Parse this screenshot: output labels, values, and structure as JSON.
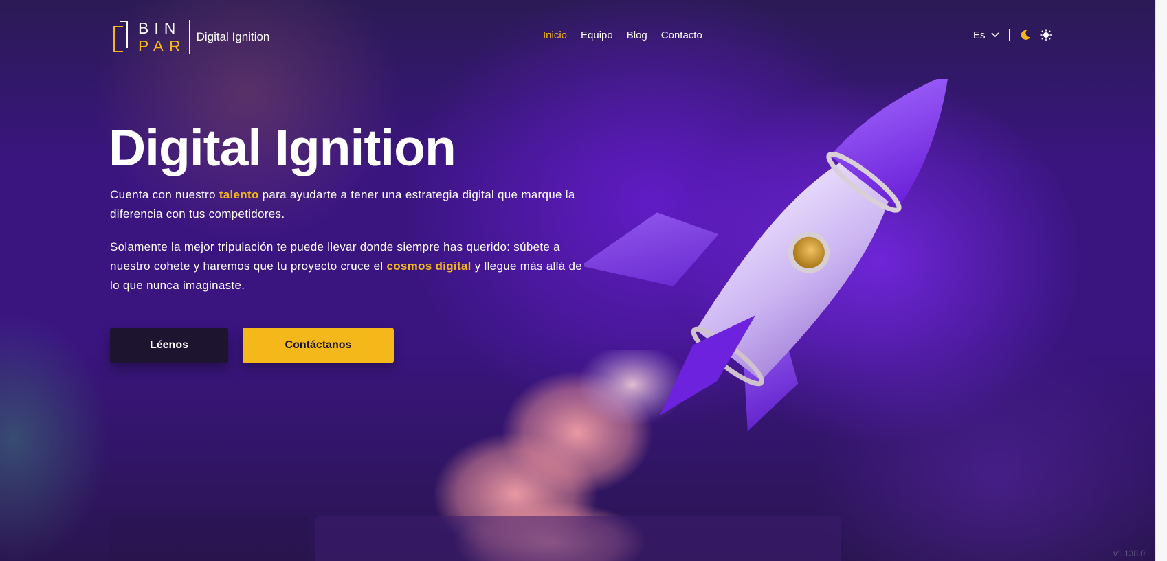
{
  "header": {
    "logo_line1": "BIN",
    "logo_line2": "PAR",
    "brand": "Digital Ignition",
    "nav": [
      {
        "label": "Inicio",
        "active": true
      },
      {
        "label": "Equipo",
        "active": false
      },
      {
        "label": "Blog",
        "active": false
      },
      {
        "label": "Contacto",
        "active": false
      }
    ],
    "language": "Es",
    "icons": [
      "chevron-down-icon",
      "moon-icon",
      "sun-icon"
    ]
  },
  "hero": {
    "title": "Digital Ignition",
    "p1_before": "Cuenta con nuestro ",
    "p1_highlight": "talento",
    "p1_after": " para ayudarte a tener una estrategia digital que marque la diferencia con tus competidores.",
    "p2_before": "Solamente la mejor tripulación te puede llevar donde siempre has querido: súbete a nuestro cohete y haremos que tu proyecto cruce el ",
    "p2_highlight": "cosmos digital",
    "p2_after": " y llegue más allá de lo que nunca imaginaste.",
    "btn_read": "Léenos",
    "btn_contact": "Contáctanos"
  },
  "version": "v1.138.0",
  "colors": {
    "accent": "#f5b81b",
    "background": "#3a1580",
    "dark_button": "#1d1530"
  }
}
